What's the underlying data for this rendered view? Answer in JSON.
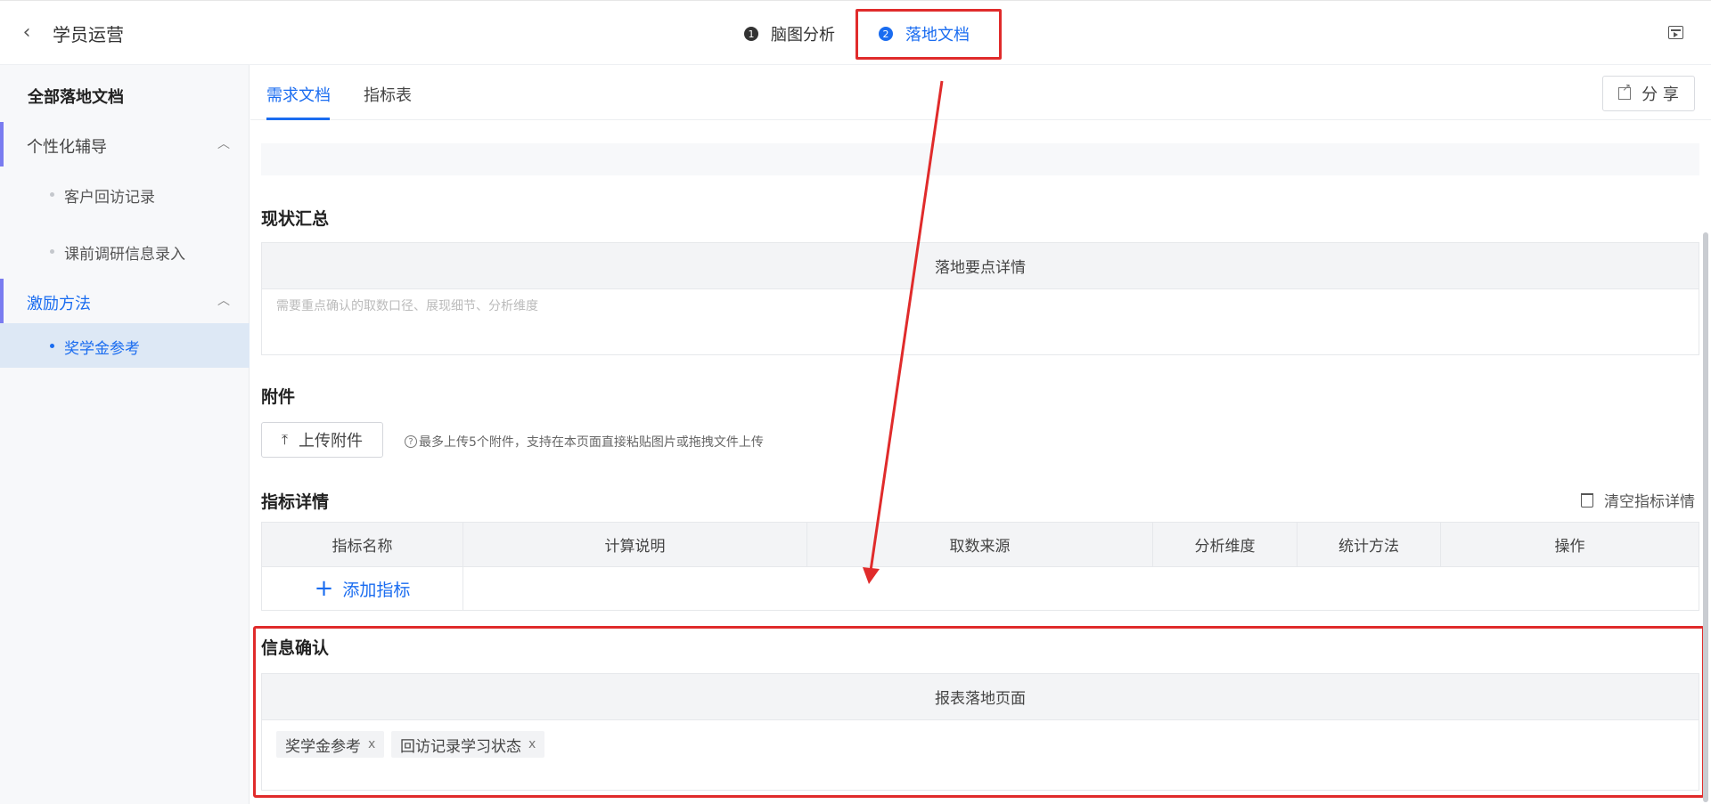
{
  "header": {
    "title": "学员运营",
    "steps": [
      {
        "num": "1",
        "label": "脑图分析"
      },
      {
        "num": "2",
        "label": "落地文档"
      }
    ]
  },
  "sidebar": {
    "heading": "全部落地文档",
    "groups": [
      {
        "label": "个性化辅导",
        "items": [
          "客户回访记录",
          "课前调研信息录入"
        ]
      },
      {
        "label": "激励方法",
        "items": [
          "奖学金参考"
        ]
      }
    ]
  },
  "tabs": [
    "需求文档",
    "指标表"
  ],
  "share_label": "分 享",
  "sections": {
    "status_summary": {
      "title": "现状汇总",
      "panel_head": "落地要点详情",
      "placeholder": "需要重点确认的取数口径、展现细节、分析维度"
    },
    "attachments": {
      "title": "附件",
      "upload_label": "上传附件",
      "hint": "最多上传5个附件，支持在本页面直接粘贴图片或拖拽文件上传"
    },
    "metrics": {
      "title": "指标详情",
      "clear_label": "清空指标详情",
      "columns": [
        "指标名称",
        "计算说明",
        "取数来源",
        "分析维度",
        "统计方法",
        "操作"
      ],
      "add_label": "添加指标"
    },
    "confirm": {
      "title": "信息确认",
      "panel_head": "报表落地页面",
      "tags": [
        "奖学金参考",
        "回访记录学习状态"
      ]
    }
  },
  "colors": {
    "accent": "#1a6cf0",
    "annotation_red": "#e02b2b"
  }
}
